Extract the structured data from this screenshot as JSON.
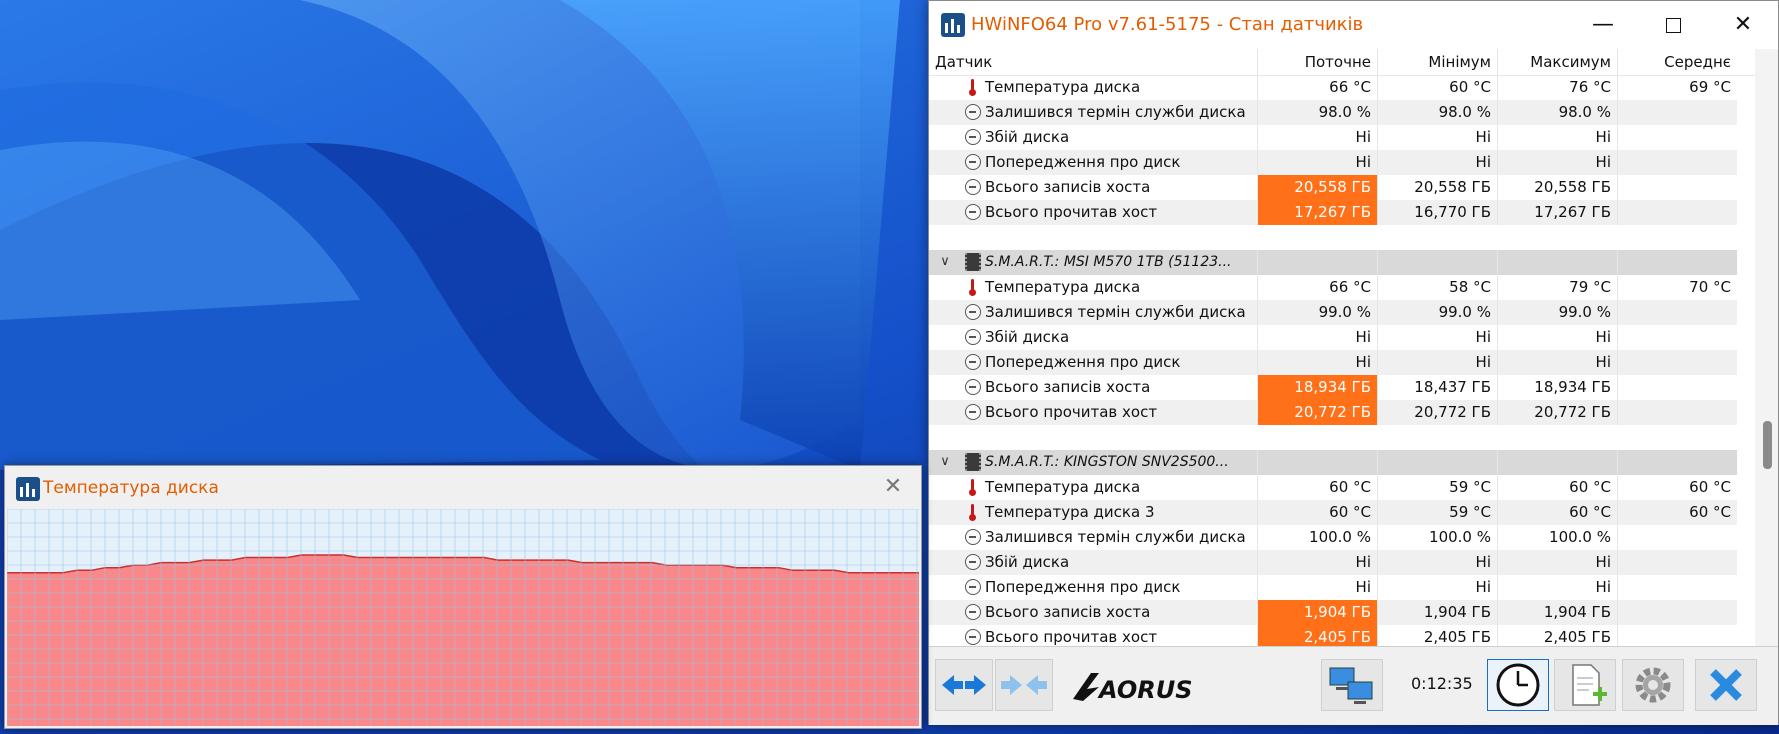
{
  "colors": {
    "accent": "#ff7019",
    "title": "#e65c00",
    "graph_fill": "#f8888a",
    "graph_line": "#c83030"
  },
  "main_window": {
    "title": "HWiNFO64 Pro v7.61-5175 - Стан датчиків",
    "buttons": {
      "minimize_icon": "minimize-icon",
      "maximize_icon": "maximize-icon",
      "close_icon": "close-icon"
    },
    "columns": [
      "Датчик",
      "Поточне",
      "Мінімум",
      "Максимум",
      "Середнє"
    ],
    "rows": [
      {
        "type": "sensor",
        "icon": "thermometer-icon",
        "label": "Температура диска",
        "current": "66 °C",
        "min": "60 °C",
        "max": "76 °C",
        "avg": "69 °C"
      },
      {
        "type": "sensor",
        "icon": "gauge-icon",
        "label": "Залишився термін служби диска",
        "current": "98.0 %",
        "min": "98.0 %",
        "max": "98.0 %",
        "avg": ""
      },
      {
        "type": "sensor",
        "icon": "gauge-icon",
        "label": "Збій диска",
        "current": "Ні",
        "min": "Ні",
        "max": "Ні",
        "avg": ""
      },
      {
        "type": "sensor",
        "icon": "gauge-icon",
        "label": "Попередження про диск",
        "current": "Ні",
        "min": "Ні",
        "max": "Ні",
        "avg": ""
      },
      {
        "type": "sensor",
        "icon": "gauge-icon",
        "label": "Всього записів хоста",
        "current": "20,558 ГБ",
        "min": "20,558 ГБ",
        "max": "20,558 ГБ",
        "avg": "",
        "highlight": true
      },
      {
        "type": "sensor",
        "icon": "gauge-icon",
        "label": "Всього прочитав хост",
        "current": "17,267 ГБ",
        "min": "16,770 ГБ",
        "max": "17,267 ГБ",
        "avg": "",
        "highlight": true
      },
      {
        "type": "empty"
      },
      {
        "type": "group",
        "label": "S.M.A.R.T.: MSI M570 1TB (51123..."
      },
      {
        "type": "sensor",
        "icon": "thermometer-icon",
        "label": "Температура диска",
        "current": "66 °C",
        "min": "58 °C",
        "max": "79 °C",
        "avg": "70 °C"
      },
      {
        "type": "sensor",
        "icon": "gauge-icon",
        "label": "Залишився термін служби диска",
        "current": "99.0 %",
        "min": "99.0 %",
        "max": "99.0 %",
        "avg": ""
      },
      {
        "type": "sensor",
        "icon": "gauge-icon",
        "label": "Збій диска",
        "current": "Ні",
        "min": "Ні",
        "max": "Ні",
        "avg": ""
      },
      {
        "type": "sensor",
        "icon": "gauge-icon",
        "label": "Попередження про диск",
        "current": "Ні",
        "min": "Ні",
        "max": "Ні",
        "avg": ""
      },
      {
        "type": "sensor",
        "icon": "gauge-icon",
        "label": "Всього записів хоста",
        "current": "18,934 ГБ",
        "min": "18,437 ГБ",
        "max": "18,934 ГБ",
        "avg": "",
        "highlight": true
      },
      {
        "type": "sensor",
        "icon": "gauge-icon",
        "label": "Всього прочитав хост",
        "current": "20,772 ГБ",
        "min": "20,772 ГБ",
        "max": "20,772 ГБ",
        "avg": "",
        "highlight": true
      },
      {
        "type": "empty"
      },
      {
        "type": "group",
        "label": "S.M.A.R.T.: KINGSTON SNV2S500..."
      },
      {
        "type": "sensor",
        "icon": "thermometer-icon",
        "label": "Температура диска",
        "current": "60 °C",
        "min": "59 °C",
        "max": "60 °C",
        "avg": "60 °C"
      },
      {
        "type": "sensor",
        "icon": "thermometer-icon",
        "label": "Температура диска 3",
        "current": "60 °C",
        "min": "59 °C",
        "max": "60 °C",
        "avg": "60 °C"
      },
      {
        "type": "sensor",
        "icon": "gauge-icon",
        "label": "Залишився термін служби диска",
        "current": "100.0 %",
        "min": "100.0 %",
        "max": "100.0 %",
        "avg": ""
      },
      {
        "type": "sensor",
        "icon": "gauge-icon",
        "label": "Збій диска",
        "current": "Ні",
        "min": "Ні",
        "max": "Ні",
        "avg": ""
      },
      {
        "type": "sensor",
        "icon": "gauge-icon",
        "label": "Попередження про диск",
        "current": "Ні",
        "min": "Ні",
        "max": "Ні",
        "avg": ""
      },
      {
        "type": "sensor",
        "icon": "gauge-icon",
        "label": "Всього записів хоста",
        "current": "1,904 ГБ",
        "min": "1,904 ГБ",
        "max": "1,904 ГБ",
        "avg": "",
        "highlight": true
      },
      {
        "type": "sensor",
        "icon": "gauge-icon",
        "label": "Всього прочитав хост",
        "current": "2,405 ГБ",
        "min": "2,405 ГБ",
        "max": "2,405 ГБ",
        "avg": "",
        "highlight": true
      }
    ],
    "toolbar": {
      "uptime": "0:12:35",
      "brand": "AORUS",
      "icons": [
        "nav-arrows-icon",
        "collapse-arrows-icon",
        "network-computers-icon",
        "clock-icon",
        "add-report-icon",
        "settings-gear-icon",
        "exit-x-icon"
      ]
    }
  },
  "graph_window": {
    "title": "Температура диска",
    "close_icon": "close-icon",
    "series_values": [
      60,
      60,
      60,
      60,
      60,
      61,
      61,
      62,
      62,
      63,
      63,
      64,
      64,
      64,
      65,
      65,
      65,
      66,
      66,
      66,
      66,
      67,
      67,
      67,
      67,
      66,
      66,
      66,
      66,
      66,
      66,
      66,
      66,
      66,
      66,
      65,
      65,
      65,
      65,
      65,
      65,
      64,
      64,
      64,
      64,
      64,
      64,
      63,
      63,
      63,
      63,
      63,
      62,
      62,
      62,
      62,
      61,
      61,
      61,
      61,
      60,
      60,
      60,
      60,
      60,
      60
    ]
  }
}
